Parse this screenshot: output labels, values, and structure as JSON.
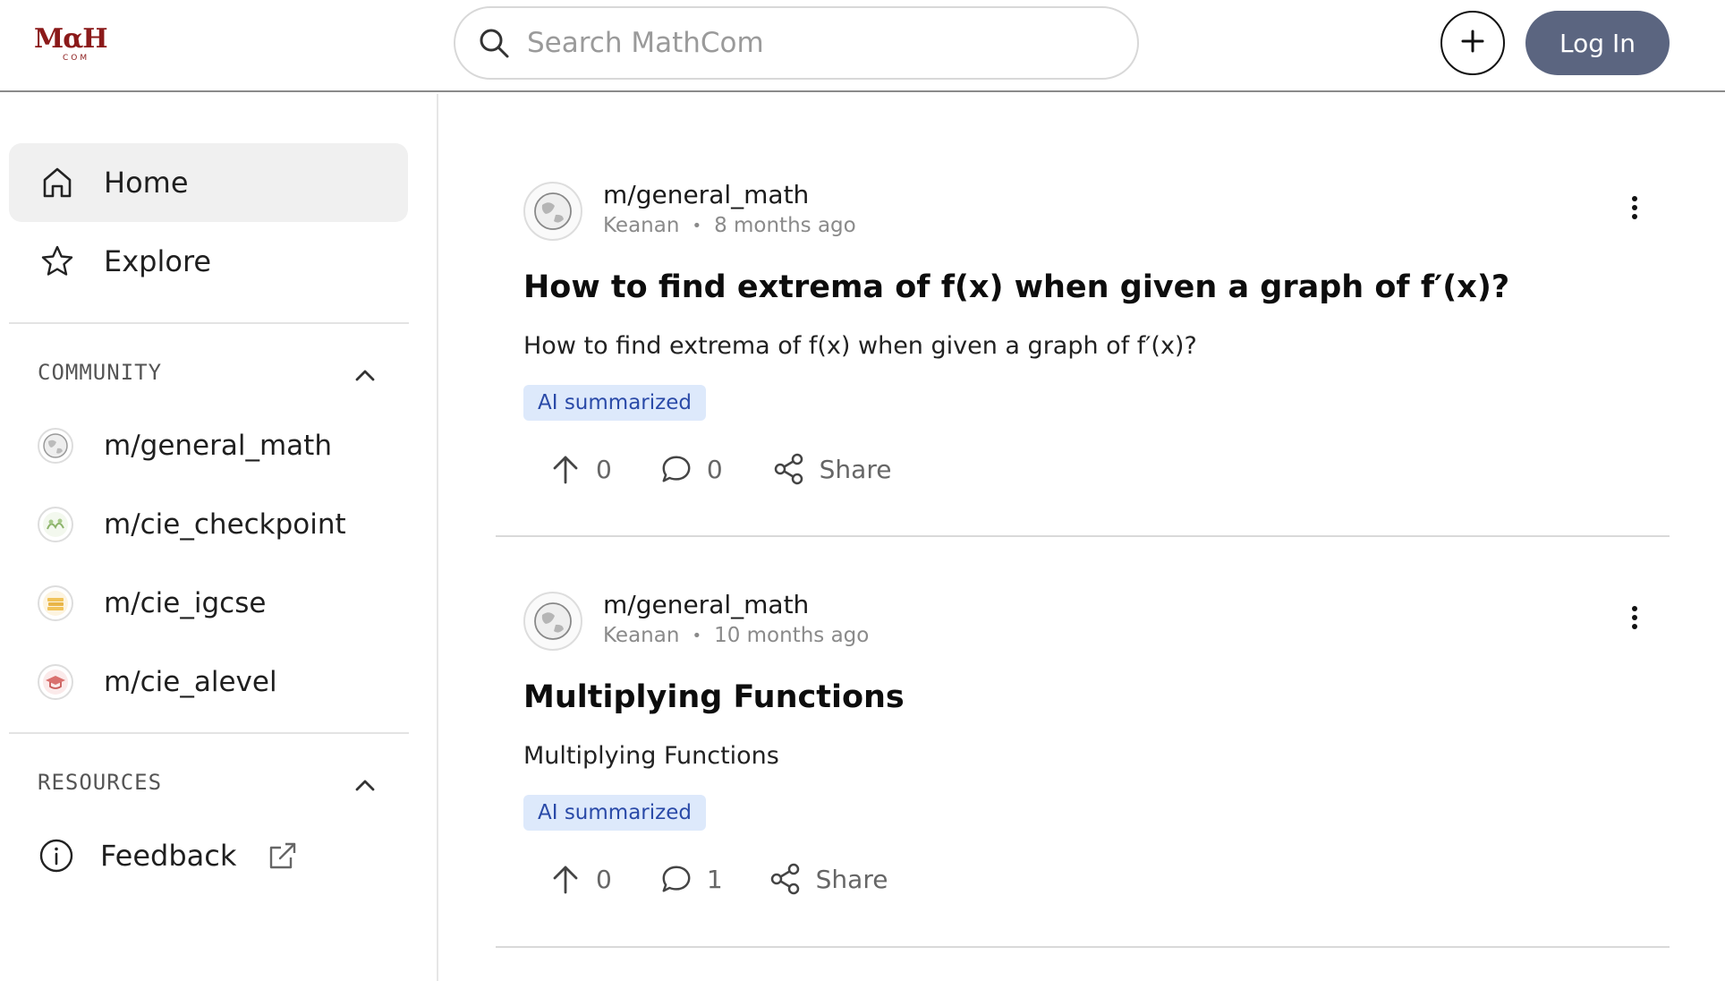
{
  "header": {
    "logo_main": "MαH",
    "logo_sub": "COM",
    "search_placeholder": "Search MathCom",
    "login_label": "Log In"
  },
  "sidebar": {
    "nav": [
      {
        "label": "Home",
        "icon": "home-icon",
        "active": true
      },
      {
        "label": "Explore",
        "icon": "star-icon",
        "active": false
      }
    ],
    "community": {
      "title": "COMMUNITY",
      "items": [
        {
          "label": "m/general_math",
          "icon": "globe-avatar"
        },
        {
          "label": "m/cie_checkpoint",
          "icon": "plant-avatar"
        },
        {
          "label": "m/cie_igcse",
          "icon": "books-avatar"
        },
        {
          "label": "m/cie_alevel",
          "icon": "graduation-cap-avatar"
        }
      ]
    },
    "resources": {
      "title": "RESOURCES",
      "items": [
        {
          "label": "Feedback",
          "icon": "info-icon"
        }
      ]
    }
  },
  "posts": [
    {
      "community": "m/general_math",
      "author": "Keanan",
      "time": "8 months ago",
      "title": "How to find extrema of f(x) when given a graph of f′(x)?",
      "body": "How to find extrema of f(x) when given a graph of f′(x)?",
      "badge": "AI summarized",
      "upvotes": "0",
      "comments": "0",
      "share_label": "Share"
    },
    {
      "community": "m/general_math",
      "author": "Keanan",
      "time": "10 months ago",
      "title": "Multiplying Functions",
      "body": "Multiplying Functions",
      "badge": "AI summarized",
      "upvotes": "0",
      "comments": "1",
      "share_label": "Share"
    }
  ],
  "colors": {
    "brand": "#8b1a1a",
    "login_bg": "#5b6580",
    "badge_bg": "#dde9fb",
    "badge_text": "#2a4aa8"
  }
}
